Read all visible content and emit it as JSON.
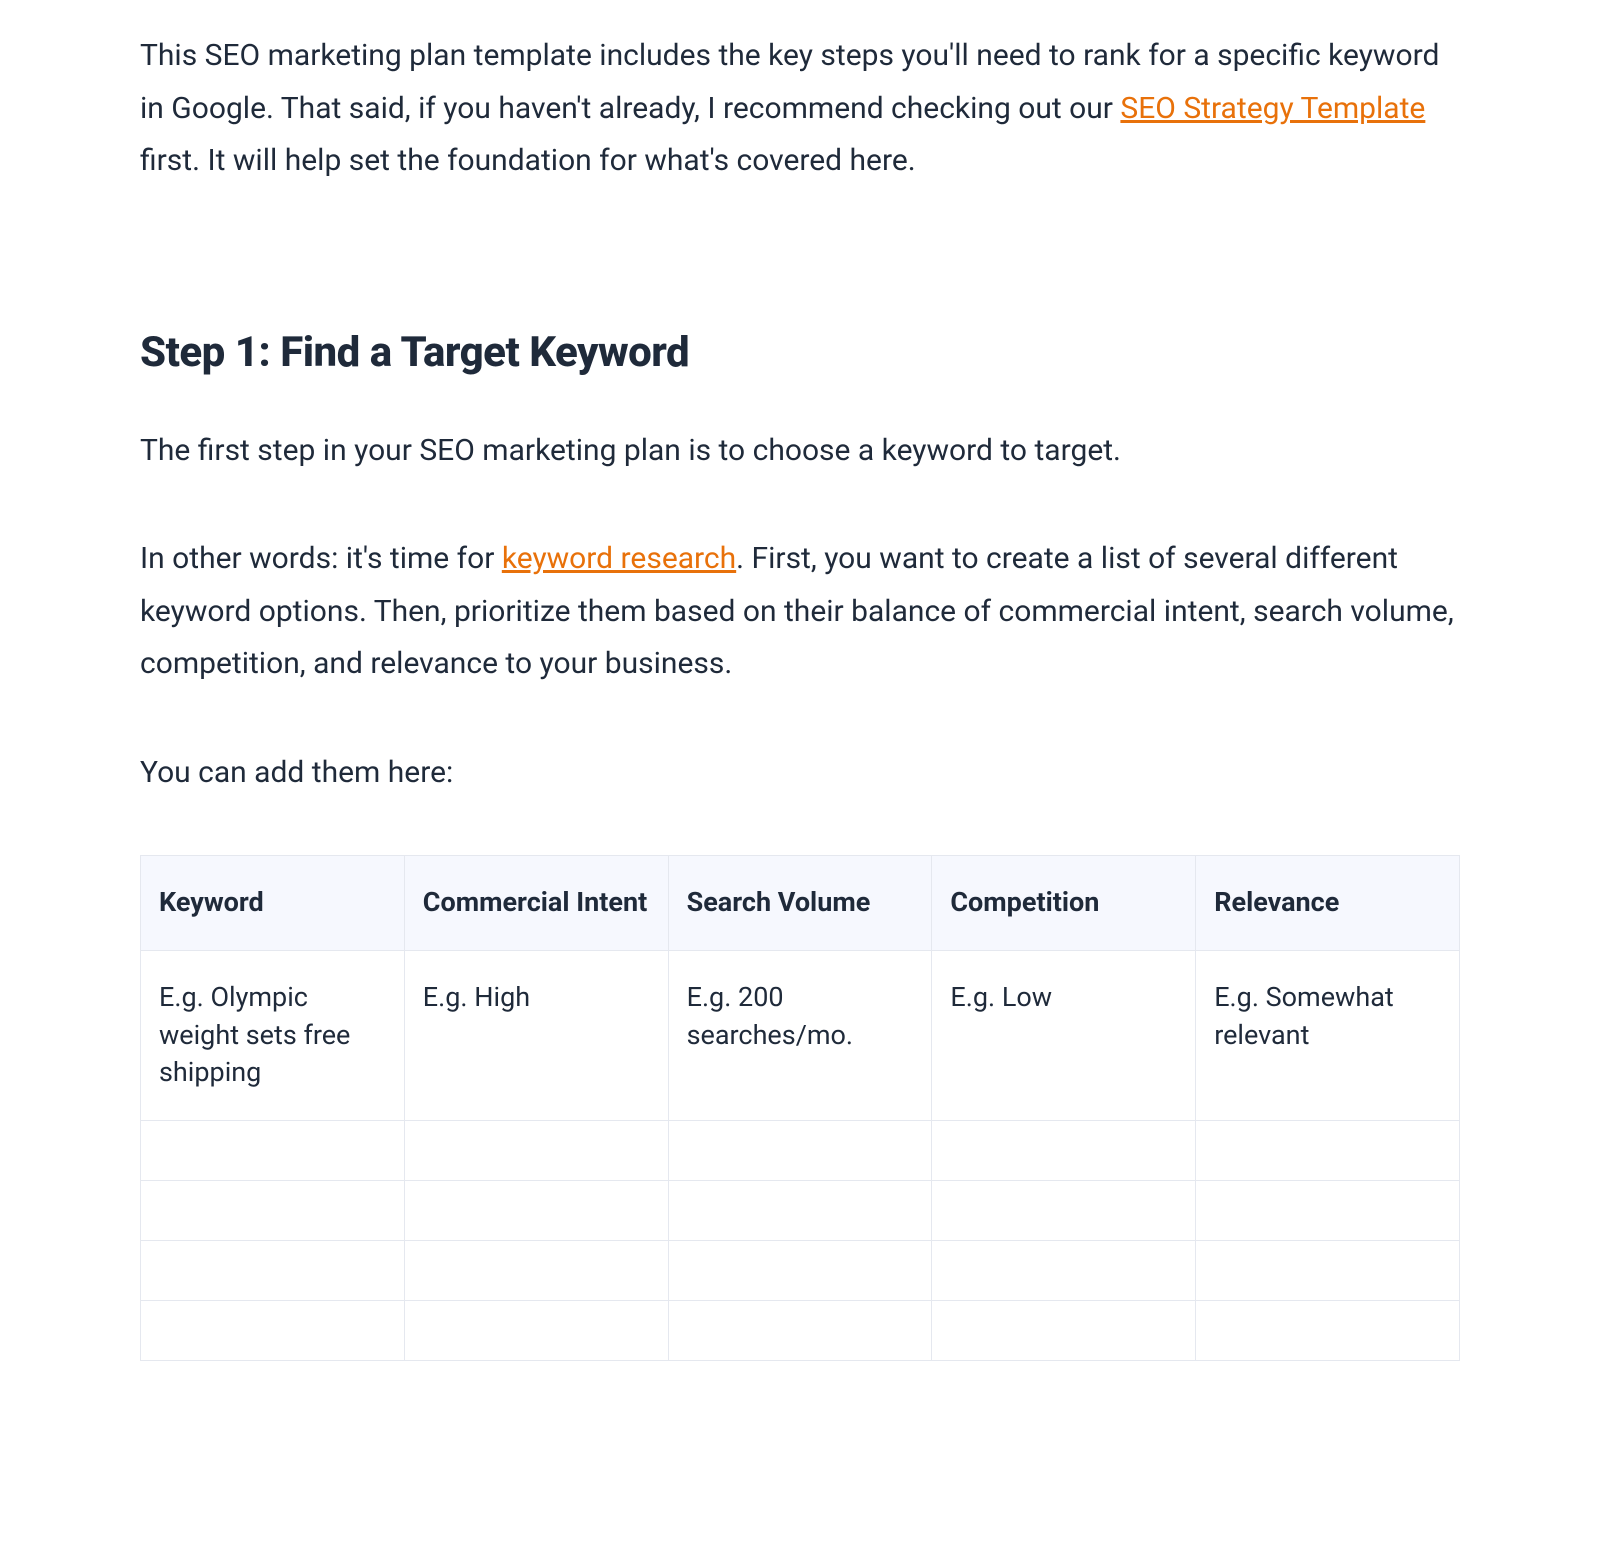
{
  "intro": {
    "text_before_link": "This SEO marketing plan template includes the key steps you'll need to rank for a specific keyword in Google. That said, if you haven't already, I recommend checking out our ",
    "link_text": "SEO Strategy Template",
    "text_after_link": " first. It will help set the foundation for what's covered here."
  },
  "step1": {
    "heading": "Step 1: Find a Target Keyword",
    "para1": "The first step in your SEO marketing plan is to choose a keyword to target.",
    "para2_before_link": "In other words: it's time for ",
    "para2_link": "keyword research",
    "para2_after_link": ". First, you want to create a list of several different keyword options. Then, prioritize them based on their balance of commercial intent, search volume, competition, and relevance to your business.",
    "para3": "You can add them here:"
  },
  "table": {
    "headers": {
      "keyword": "Keyword",
      "commercial_intent": "Commercial Intent",
      "search_volume": "Search Volume",
      "competition": "Competition",
      "relevance": "Relevance"
    },
    "row1": {
      "keyword": "E.g. Olympic weight sets free shipping",
      "commercial_intent": "E.g. High",
      "search_volume": "E.g. 200 searches/mo.",
      "competition": "E.g. Low",
      "relevance": "E.g. Somewhat relevant"
    }
  }
}
